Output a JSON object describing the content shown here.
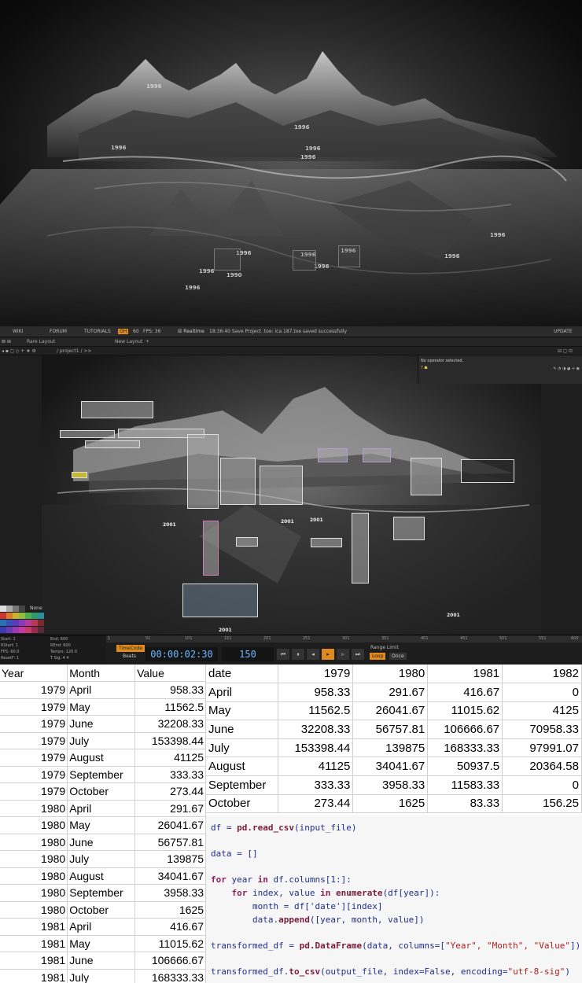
{
  "render_labels": [
    "1996",
    "1996",
    "1996",
    "1996",
    "1996",
    "1996",
    "1990",
    "1996",
    "1996",
    "1996",
    "1996",
    "1996",
    "1996",
    "1996"
  ],
  "td": {
    "menubar": [
      "WIKI",
      "FORUM",
      "TUTORIALS",
      "OH",
      "60",
      "FPS: 36",
      "Realtime",
      "18:36:40 Save Project .toe: ica 187.toe saved successfully",
      "UPDATE"
    ],
    "layout": [
      "Rare Layout",
      "New Layout"
    ],
    "path": "/ project1 / >>",
    "param_title": "No operator selected.",
    "palette_none": "None",
    "net_labels": [
      "2001",
      "2001",
      "2001",
      "2001",
      "2001",
      "2001"
    ],
    "stats": [
      "Start:  1",
      "End:  600",
      "RStart:  1",
      "REnd:  600",
      "FPS:  60.0",
      "Tempo:  120.0",
      "ResetF:  1",
      "T Sig:  4   4"
    ],
    "ruler": [
      "1",
      "51",
      "101",
      "151",
      "201",
      "251",
      "301",
      "351",
      "401",
      "451",
      "501",
      "551",
      "600"
    ],
    "timecode_btn": "TimeCode",
    "beats_btn": "Beats",
    "timecode": "00:00:02:30",
    "frame": "150",
    "range_limit": "Range Limit",
    "loop": "Loop",
    "once": "Once"
  },
  "long_table": {
    "headers": [
      "Year",
      "Month",
      "Value"
    ],
    "rows": [
      [
        "1979",
        "April",
        "958.33"
      ],
      [
        "1979",
        "May",
        "11562.5"
      ],
      [
        "1979",
        "June",
        "32208.33"
      ],
      [
        "1979",
        "July",
        "153398.44"
      ],
      [
        "1979",
        "August",
        "41125"
      ],
      [
        "1979",
        "September",
        "333.33"
      ],
      [
        "1979",
        "October",
        "273.44"
      ],
      [
        "1980",
        "April",
        "291.67"
      ],
      [
        "1980",
        "May",
        "26041.67"
      ],
      [
        "1980",
        "June",
        "56757.81"
      ],
      [
        "1980",
        "July",
        "139875"
      ],
      [
        "1980",
        "August",
        "34041.67"
      ],
      [
        "1980",
        "September",
        "3958.33"
      ],
      [
        "1980",
        "October",
        "1625"
      ],
      [
        "1981",
        "April",
        "416.67"
      ],
      [
        "1981",
        "May",
        "11015.62"
      ],
      [
        "1981",
        "June",
        "106666.67"
      ],
      [
        "1981",
        "July",
        "168333.33"
      ]
    ]
  },
  "wide_table": {
    "headers": [
      "date",
      "1979",
      "1980",
      "1981",
      "1982"
    ],
    "rows": [
      [
        "April",
        "958.33",
        "291.67",
        "416.67",
        "0"
      ],
      [
        "May",
        "11562.5",
        "26041.67",
        "11015.62",
        "4125"
      ],
      [
        "June",
        "32208.33",
        "56757.81",
        "106666.67",
        "70958.33"
      ],
      [
        "July",
        "153398.44",
        "139875",
        "168333.33",
        "97991.07"
      ],
      [
        "August",
        "41125",
        "34041.67",
        "50937.5",
        "20364.58"
      ],
      [
        "September",
        "333.33",
        "3958.33",
        "11583.33",
        "0"
      ],
      [
        "October",
        "273.44",
        "1625",
        "83.33",
        "156.25"
      ]
    ]
  },
  "code": {
    "l1a": "df = ",
    "l1b": "pd.read_csv",
    "l1c": "(input_file)",
    "l2": "data = []",
    "l3a": "for",
    "l3b": " year ",
    "l3c": "in",
    "l3d": " df.columns[1:]:",
    "l4a": "    for",
    "l4b": " index, value ",
    "l4c": "in",
    "l4d": " ",
    "l4e": "enumerate",
    "l4f": "(df[year]):",
    "l5": "        month = df['date'][index]",
    "l6a": "        data.",
    "l6b": "append",
    "l6c": "([year, month, value])",
    "l7a": "transformed_df = ",
    "l7b": "pd.DataFrame",
    "l7c": "(data, columns=[",
    "l7d": "\"Year\", \"Month\", \"Value\"",
    "l7e": "])",
    "l8a": "transformed_df.",
    "l8b": "to_csv",
    "l8c": "(output_file, index=False, encoding=",
    "l8d": "\"utf-8-sig\"",
    "l8e": ")"
  }
}
